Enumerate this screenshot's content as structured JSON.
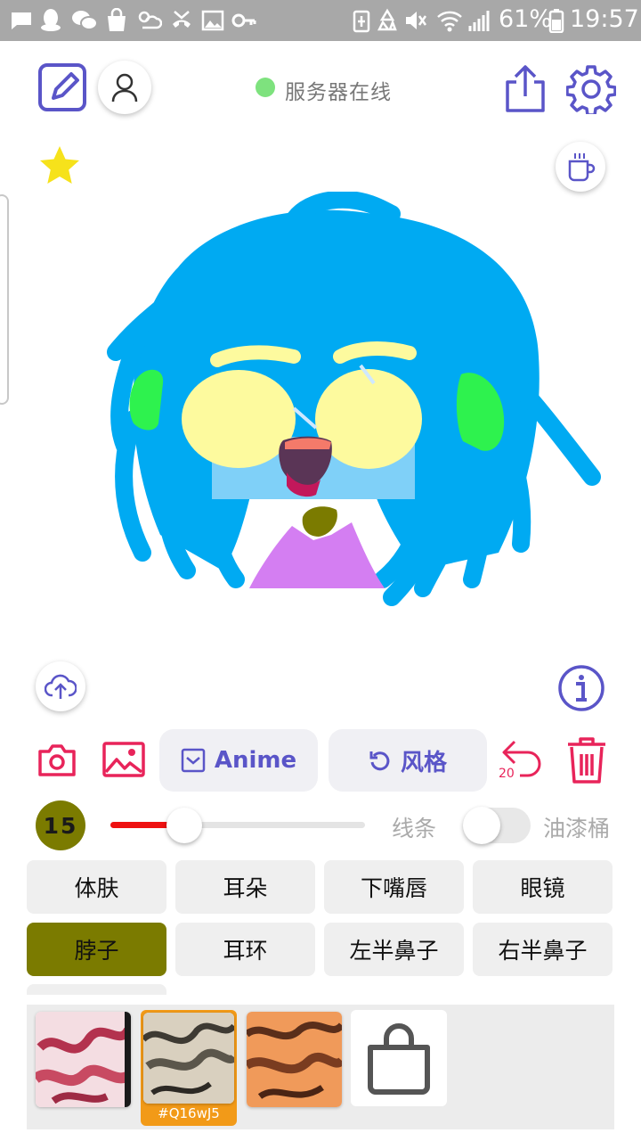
{
  "status_bar": {
    "battery": "61%",
    "time": "19:57"
  },
  "server": {
    "status_text": "服务器在线",
    "status_color": "#7ee27e"
  },
  "toolbar": {
    "anime_label": "Anime",
    "style_label": "风格",
    "undo_count": "20"
  },
  "brush": {
    "size": "15",
    "size_fraction": 0.29,
    "color": "#7b7b00",
    "mode_line": "线条",
    "mode_bucket": "油漆桶",
    "bucket_enabled": false
  },
  "parts": [
    {
      "label": "体肤",
      "selected": false
    },
    {
      "label": "耳朵",
      "selected": false
    },
    {
      "label": "下嘴唇",
      "selected": false
    },
    {
      "label": "眼镜",
      "selected": false
    },
    {
      "label": "脖子",
      "selected": true
    },
    {
      "label": "耳环",
      "selected": false
    },
    {
      "label": "左半鼻子",
      "selected": false
    },
    {
      "label": "右半鼻子",
      "selected": false
    }
  ],
  "textures": {
    "selected_code": "#Q16wJ5"
  },
  "colors": {
    "accent": "#5a55c8",
    "danger": "#e8245a",
    "hair": "#00aaf2",
    "skin": "#7fd0f8",
    "eyes": "#fdfa9e",
    "ears": "#2ef24e",
    "neck": "#7b7b00",
    "shirt": "#d47ef2"
  }
}
